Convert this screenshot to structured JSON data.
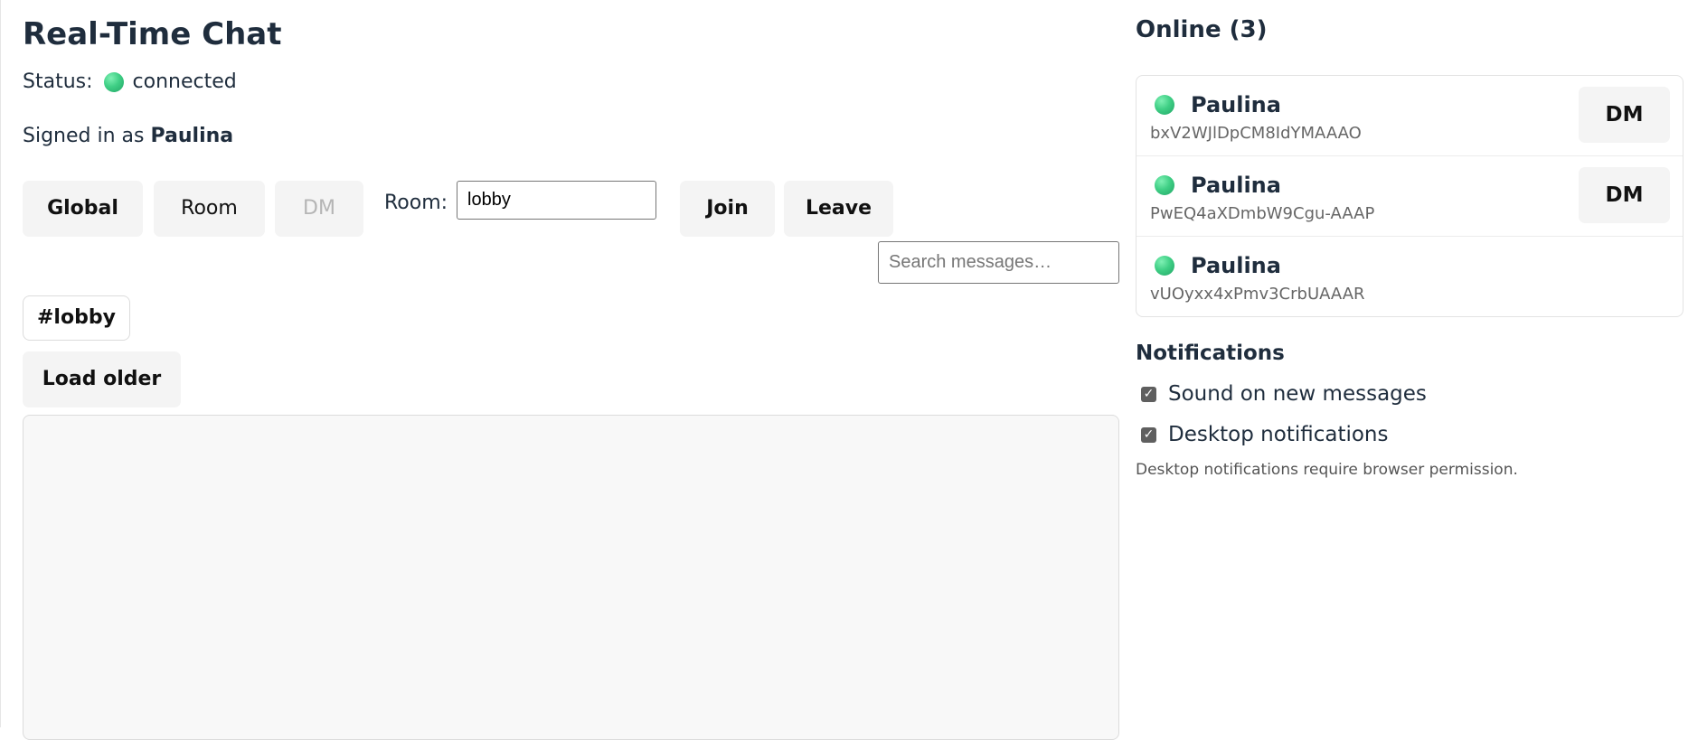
{
  "app": {
    "title": "Real-Time Chat",
    "status_label": "Status:",
    "status_value": "connected",
    "signed_in_prefix": "Signed in as",
    "signed_in_user": "Paulina"
  },
  "toolbar": {
    "global_label": "Global",
    "room_label": "Room",
    "dm_label": "DM",
    "room_field_label": "Room:",
    "room_value": "lobby",
    "join_label": "Join",
    "leave_label": "Leave"
  },
  "search": {
    "placeholder": "Search messages…"
  },
  "current_room": {
    "chip": "#lobby",
    "load_older_label": "Load older"
  },
  "online": {
    "title": "Online (3)",
    "users": [
      {
        "name": "Paulina",
        "id": "bxV2WJlDpCM8IdYMAAAO",
        "dm_label": "DM"
      },
      {
        "name": "Paulina",
        "id": "PwEQ4aXDmbW9Cgu-AAAP",
        "dm_label": "DM"
      },
      {
        "name": "Paulina",
        "id": "vUOyxx4xPmv3CrbUAAAR"
      }
    ]
  },
  "notifications": {
    "title": "Notifications",
    "sound_label": "Sound on new messages",
    "sound_checked": true,
    "desktop_label": "Desktop notifications",
    "desktop_checked": true,
    "note": "Desktop notifications require browser permission."
  },
  "colors": {
    "online_dot": "#3fcf85",
    "text": "#1f2d3d",
    "button_bg": "#f4f4f4"
  }
}
